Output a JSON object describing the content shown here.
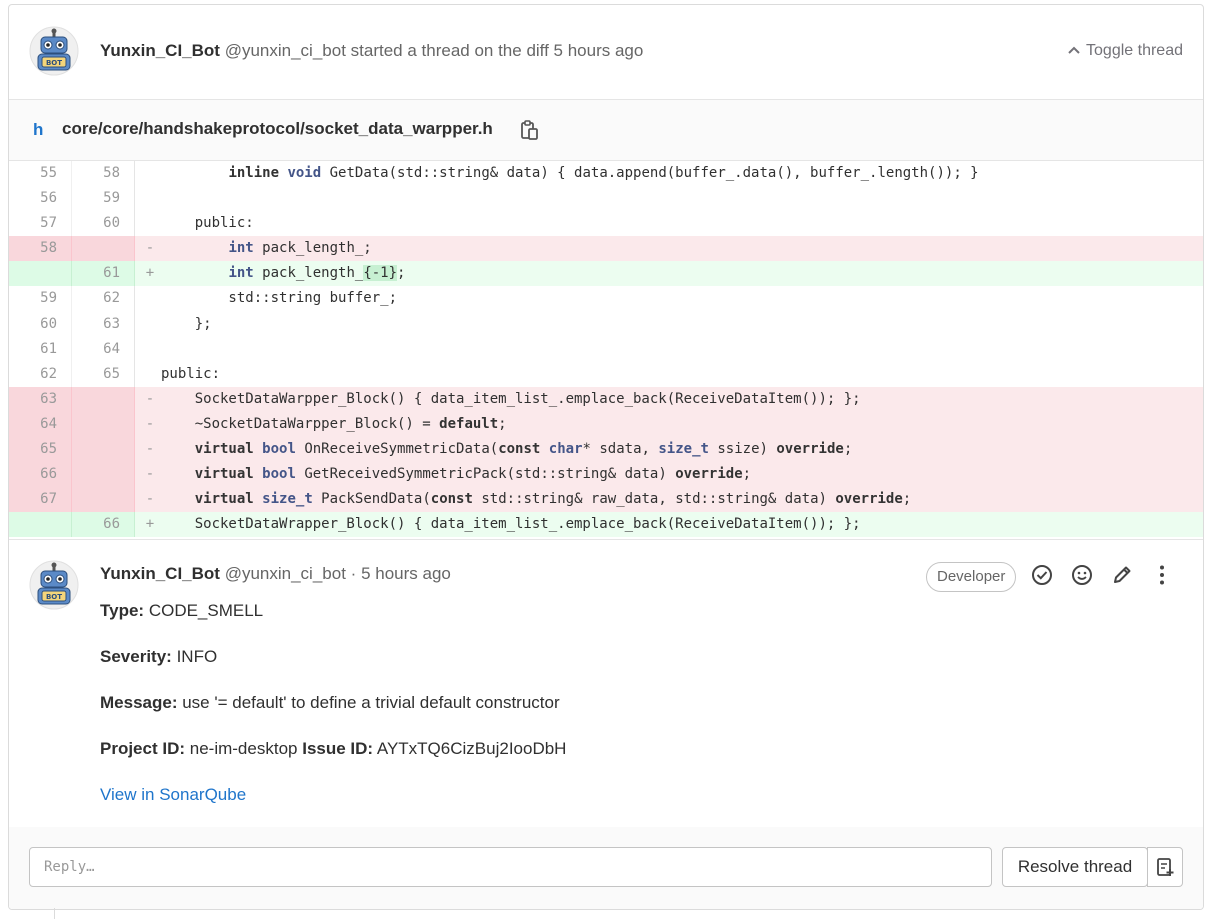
{
  "thread_header": {
    "author_name": "Yunxin_CI_Bot",
    "author_handle": "@yunxin_ci_bot",
    "action_text": "started a thread on the diff",
    "time": "5 hours ago",
    "toggle_label": "Toggle thread",
    "avatar_icon": "robot-avatar-icon"
  },
  "file": {
    "icon": "h",
    "path": "core/core/handshakeprotocol/socket_data_warpper.h"
  },
  "diff_lines": [
    {
      "old": "55",
      "new": "58",
      "type": "context",
      "sign": "",
      "code": "        inline void GetData(std::string& data) { data.append(buffer_.data(), buffer_.length()); }"
    },
    {
      "old": "56",
      "new": "59",
      "type": "context",
      "sign": "",
      "code": ""
    },
    {
      "old": "57",
      "new": "60",
      "type": "context",
      "sign": "",
      "code": "    public:"
    },
    {
      "old": "58",
      "new": "",
      "type": "old",
      "sign": "-",
      "code": "        int pack_length_;"
    },
    {
      "old": "",
      "new": "61",
      "type": "new",
      "sign": "+",
      "code": "        int pack_length_{-1};"
    },
    {
      "old": "59",
      "new": "62",
      "type": "context",
      "sign": "",
      "code": "        std::string buffer_;"
    },
    {
      "old": "60",
      "new": "63",
      "type": "context",
      "sign": "",
      "code": "    };"
    },
    {
      "old": "61",
      "new": "64",
      "type": "context",
      "sign": "",
      "code": ""
    },
    {
      "old": "62",
      "new": "65",
      "type": "context",
      "sign": "",
      "code": "public:"
    },
    {
      "old": "63",
      "new": "",
      "type": "old",
      "sign": "-",
      "code": "    SocketDataWarpper_Block() { data_item_list_.emplace_back(ReceiveDataItem()); };"
    },
    {
      "old": "64",
      "new": "",
      "type": "old",
      "sign": "-",
      "code": "    ~SocketDataWarpper_Block() = default;"
    },
    {
      "old": "65",
      "new": "",
      "type": "old",
      "sign": "-",
      "code": "    virtual bool OnReceiveSymmetricData(const char* sdata, size_t ssize) override;"
    },
    {
      "old": "66",
      "new": "",
      "type": "old",
      "sign": "-",
      "code": "    virtual bool GetReceivedSymmetricPack(std::string& data) override;"
    },
    {
      "old": "67",
      "new": "",
      "type": "old",
      "sign": "-",
      "code": "    virtual size_t PackSendData(const std::string& raw_data, std::string& data) override;"
    },
    {
      "old": "",
      "new": "66",
      "type": "new",
      "sign": "+",
      "code": "    SocketDataWrapper_Block() { data_item_list_.emplace_back(ReceiveDataItem()); };"
    }
  ],
  "note": {
    "author_name": "Yunxin_CI_Bot",
    "author_handle": "@yunxin_ci_bot",
    "separator": "·",
    "time": "5 hours ago",
    "role": "Developer",
    "type_label": "Type:",
    "type_value": "CODE_SMELL",
    "severity_label": "Severity:",
    "severity_value": "INFO",
    "message_label": "Message:",
    "message_value": "use '= default' to define a trivial default constructor",
    "project_label": "Project ID:",
    "project_value": "ne-im-desktop",
    "issue_label": "Issue ID:",
    "issue_value": "AYTxTQ6CizBuj2IooDbH",
    "link_label": "View in SonarQube"
  },
  "reply": {
    "placeholder": "Reply…",
    "resolve_label": "Resolve thread"
  },
  "colors": {
    "link": "#1f75cb",
    "removed_bg": "#fbe9eb",
    "added_bg": "#ecfdf0"
  }
}
